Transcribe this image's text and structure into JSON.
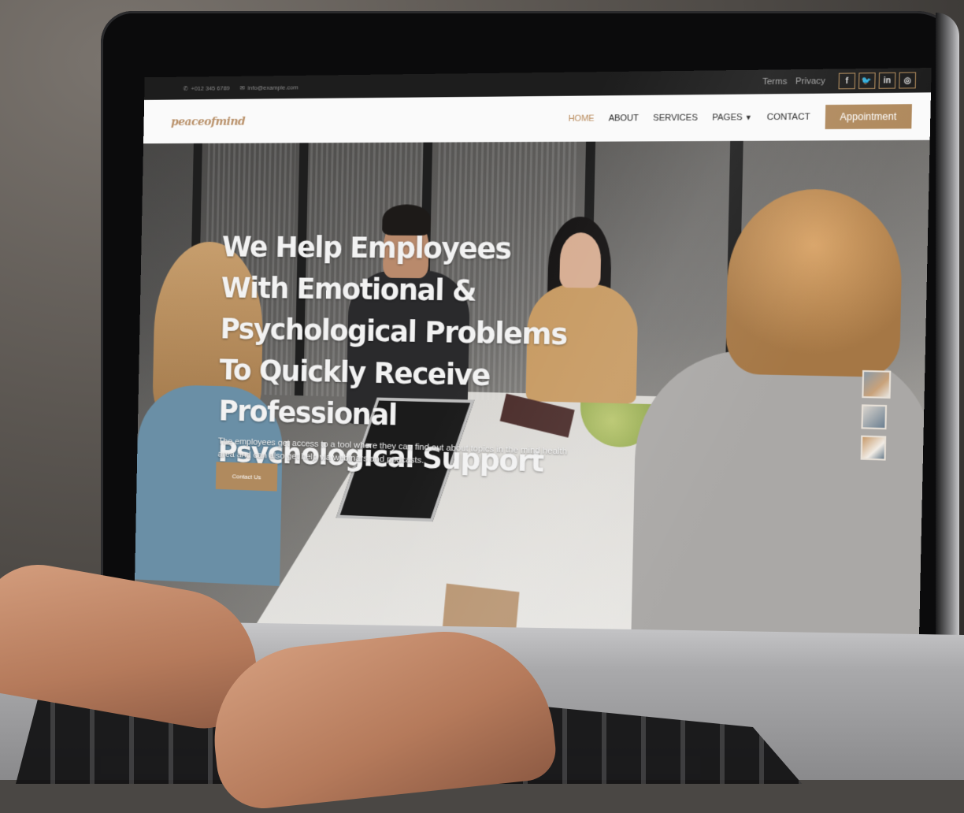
{
  "topbar": {
    "phone": "+012 345 6789",
    "email": "info@example.com",
    "links": [
      "Terms",
      "Privacy"
    ],
    "social": [
      {
        "icon": "facebook-icon",
        "glyph": "f"
      },
      {
        "icon": "twitter-icon",
        "glyph": "t"
      },
      {
        "icon": "linkedin-icon",
        "glyph": "in"
      },
      {
        "icon": "instagram-icon",
        "glyph": "◎"
      }
    ]
  },
  "navbar": {
    "logo": "peaceofmind",
    "items": [
      "HOME",
      "ABOUT",
      "SERVICES",
      "PAGES",
      "CONTACT"
    ],
    "active": "HOME",
    "appointment_label": "Appointment"
  },
  "hero": {
    "title": "We Help Employees With Emotional & Psychological Problems To Quickly Receive Professional Psychological Support",
    "text": "The employees get access to a tool where they can find out about topics in the mind health area and can also get help via webinars and podcasts.",
    "button_label": "Contact Us"
  },
  "colors": {
    "accent": "#b08a5e",
    "topbar_bg": "#1d1d1d",
    "navbar_bg": "#fafafa"
  }
}
